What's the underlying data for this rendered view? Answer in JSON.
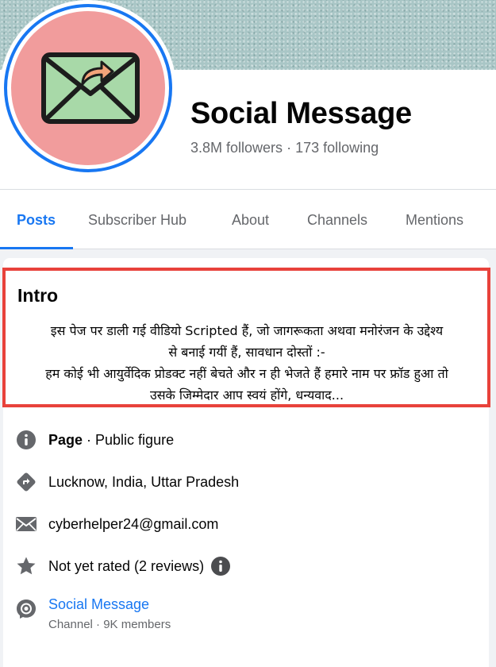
{
  "profile": {
    "name": "Social Message",
    "followers": "3.8M followers",
    "separator": "·",
    "following": "173 following"
  },
  "tabs": [
    {
      "label": "Posts",
      "active": true
    },
    {
      "label": "Subscriber Hub",
      "active": false
    },
    {
      "label": "About",
      "active": false
    },
    {
      "label": "Channels",
      "active": false
    },
    {
      "label": "Mentions",
      "active": false
    }
  ],
  "intro": {
    "title": "Intro",
    "text": "इस पेज पर डाली गई वीडियो Scripted हैं, जो जागरूकता अथवा मनोरंजन के उद्देश्य\nसे बनाई गयीं हैं, सावधान दोस्तों :-\nहम कोई भी आयुर्वेदिक प्रोडक्ट नहीं बेचते और न ही भेजते हैं हमारे नाम पर फ्रॉड हुआ तो\nउसके जिम्मेदार आप स्वयं होंगे, धन्यवाद..."
  },
  "details": {
    "category_label": "Page",
    "category_value": " · Public figure",
    "location": "Lucknow, India, Uttar Pradesh",
    "email": "cyberhelper24@gmail.com",
    "rating": "Not yet rated (2 reviews)",
    "channel_name": "Social Message",
    "channel_meta": "Channel · 9K members"
  },
  "icons": {
    "info": "info-circle-icon",
    "directions": "directions-icon",
    "mail": "mail-icon",
    "star": "star-icon",
    "channel": "channel-icon",
    "avatar": "envelope-forward-logo"
  },
  "colors": {
    "accent": "#1877f2",
    "highlight_border": "#e8423b",
    "avatar_bg": "#f19c9c",
    "envelope": "#a8d9a8",
    "secondary_text": "#65676b"
  }
}
